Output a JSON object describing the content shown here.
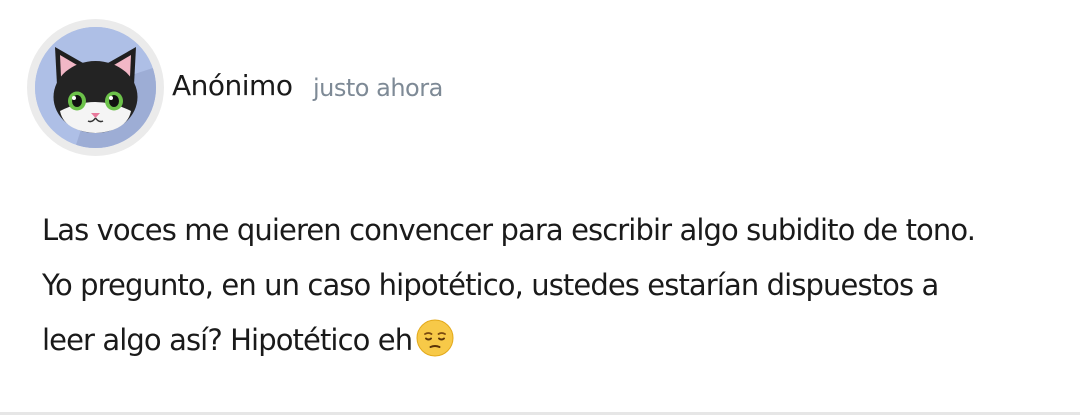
{
  "post": {
    "author": "Anónimo",
    "timestamp": "justo ahora",
    "text_lines": [
      "Las voces me quieren convencer para escribir algo subidito de tono.",
      "Yo pregunto, en un caso hipotético, ustedes estarían dispuestos a",
      "leer algo así? Hipotético eh"
    ],
    "emoji": "pensive-face-icon",
    "avatar_icon": "cat-avatar-icon"
  },
  "colors": {
    "avatar_background": "#aebfe6",
    "avatar_ring": "#ebebeb",
    "timestamp": "#7e8a96",
    "text": "#1a1a1a"
  }
}
